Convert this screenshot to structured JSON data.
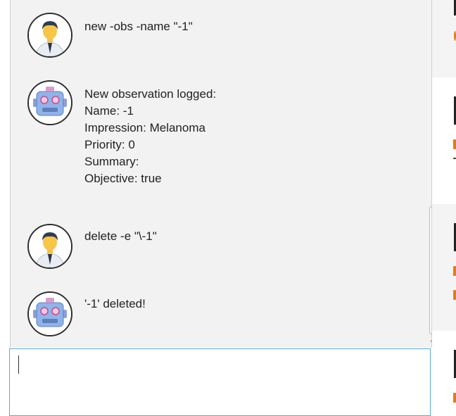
{
  "chat": {
    "messages": [
      {
        "sender": "user",
        "avatar_icon": "user-avatar-icon",
        "text": "new -obs -name \"-1\""
      },
      {
        "sender": "bot",
        "avatar_icon": "robot-avatar-icon",
        "text": "New observation logged:\nName: -1\nImpression: Melanoma\nPriority: 0\nSummary:\nObjective: true"
      },
      {
        "sender": "user",
        "avatar_icon": "user-avatar-icon",
        "text": "delete -e \"\\-1\""
      },
      {
        "sender": "bot",
        "avatar_icon": "robot-avatar-icon",
        "text": "'-1' deleted!"
      }
    ]
  },
  "input": {
    "value": "",
    "placeholder": ""
  },
  "colors": {
    "panel_bg": "#f2f2f2",
    "input_border": "#5aa6d6",
    "accent_orange": "#e07b1f",
    "avatar_border": "#2d2d2d"
  }
}
